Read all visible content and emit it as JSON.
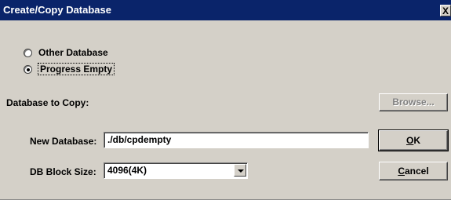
{
  "window": {
    "title": "Create/Copy Database",
    "close_label": "X"
  },
  "options": [
    {
      "label": "Other Database",
      "checked": false
    },
    {
      "label": "Progress Empty",
      "checked": true
    }
  ],
  "copy_label": "Database to Copy:",
  "browse_label": "Browse...",
  "new_db": {
    "label": "New Database:",
    "value": "./db/cpdempty"
  },
  "block_size": {
    "label": "DB Block Size:",
    "value": "4096(4K)"
  },
  "buttons": {
    "ok_accel": "O",
    "ok_rest": "K",
    "cancel_accel": "C",
    "cancel_rest": "ancel"
  }
}
